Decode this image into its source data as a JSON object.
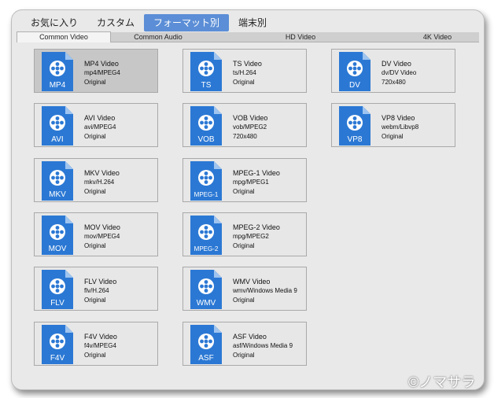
{
  "top_tabs": [
    "お気に入り",
    "カスタム",
    "フォーマット別",
    "端末別"
  ],
  "sub_tabs": [
    "Common Video",
    "Common Audio",
    "HD Video",
    "4K Video"
  ],
  "colors": {
    "accent": "#5b8ed6",
    "icon_blue": "#2b78d4",
    "icon_fold": "#9ec4ef",
    "selected_card": "#c7c7c7"
  },
  "formats": [
    {
      "badge": "MP4",
      "title": "MP4 Video",
      "spec": "mp4/MPEG4",
      "quality": "Original"
    },
    {
      "badge": "TS",
      "title": "TS Video",
      "spec": "ts/H.264",
      "quality": "Original"
    },
    {
      "badge": "DV",
      "title": "DV Video",
      "spec": "dv/DV Video",
      "quality": "720x480"
    },
    {
      "badge": "AVI",
      "title": "AVI Video",
      "spec": "avi/MPEG4",
      "quality": "Original"
    },
    {
      "badge": "VOB",
      "title": "VOB Video",
      "spec": "vob/MPEG2",
      "quality": "720x480"
    },
    {
      "badge": "VP8",
      "title": "VP8 Video",
      "spec": "webm/Libvp8",
      "quality": "Original"
    },
    {
      "badge": "MKV",
      "title": "MKV Video",
      "spec": "mkv/H.264",
      "quality": "Original"
    },
    {
      "badge": "MPEG-1",
      "title": "MPEG-1 Video",
      "spec": "mpg/MPEG1",
      "quality": "Original"
    },
    {
      "badge": "MOV",
      "title": "MOV Video",
      "spec": "mov/MPEG4",
      "quality": "Original"
    },
    {
      "badge": "MPEG-2",
      "title": "MPEG-2 Video",
      "spec": "mpg/MPEG2",
      "quality": "Original"
    },
    {
      "badge": "FLV",
      "title": "FLV Video",
      "spec": "flv/H.264",
      "quality": "Original"
    },
    {
      "badge": "WMV",
      "title": "WMV Video",
      "spec": "wmv/Windows Media 9",
      "quality": "Original"
    },
    {
      "badge": "F4V",
      "title": "F4V Video",
      "spec": "f4v/MPEG4",
      "quality": "Original"
    },
    {
      "badge": "ASF",
      "title": "ASF Video",
      "spec": "asf/Windows Media 9",
      "quality": "Original"
    }
  ],
  "watermark": "©ノマサラ"
}
